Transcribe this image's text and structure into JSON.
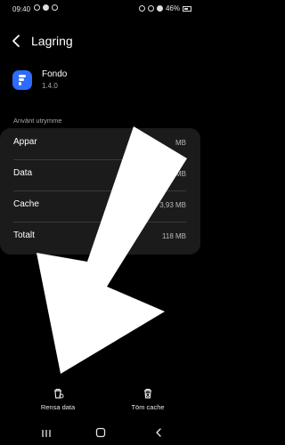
{
  "status_bar": {
    "time": "09:40",
    "battery": "46%"
  },
  "header": {
    "title": "Lagring"
  },
  "app": {
    "name": "Fondo",
    "version": "1.4.0",
    "icon_color": "#2e6bff"
  },
  "storage": {
    "section_title": "Använt utrymme",
    "rows": [
      {
        "label": "Appar",
        "value": "MB"
      },
      {
        "label": "Data",
        "value": "MB"
      },
      {
        "label": "Cache",
        "value": "3,93 MB"
      },
      {
        "label": "Totalt",
        "value": "118 MB"
      }
    ]
  },
  "actions": {
    "clear_data": {
      "label": "Rensa data",
      "icon": "trash-data-icon"
    },
    "clear_cache": {
      "label": "Töm cache",
      "icon": "trash-cache-icon"
    }
  },
  "nav": {
    "recents": "recents-icon",
    "home": "home-icon",
    "back": "back-icon"
  },
  "colors": {
    "background": "#000000",
    "card": "#1b1b1b",
    "arrow": "#ffffff"
  }
}
